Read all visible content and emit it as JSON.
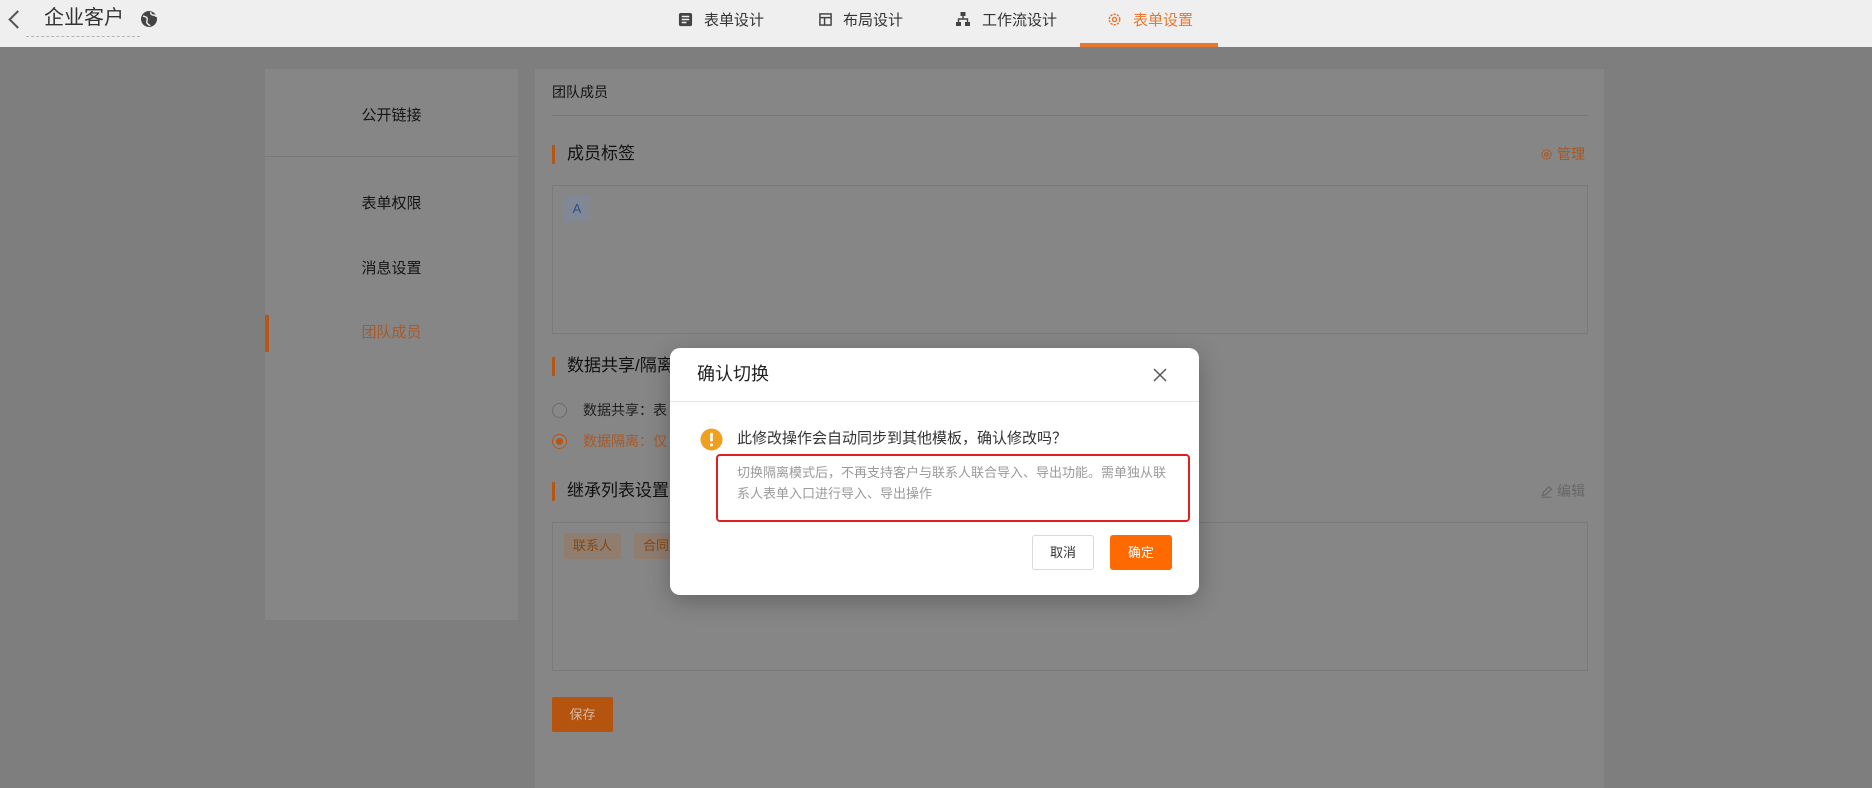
{
  "header": {
    "title": "企业客户",
    "back_icon": "chevron-left-icon",
    "globe_icon": "globe-icon",
    "tabs": [
      {
        "label": "表单设计",
        "icon": "form-icon",
        "active": false
      },
      {
        "label": "布局设计",
        "icon": "layout-icon",
        "active": false
      },
      {
        "label": "工作流设计",
        "icon": "workflow-icon",
        "active": false
      },
      {
        "label": "表单设置",
        "icon": "settings-icon",
        "active": true
      }
    ]
  },
  "sidebar": {
    "items": [
      {
        "label": "公开链接",
        "active": false
      },
      {
        "label": "表单权限",
        "active": false
      },
      {
        "label": "消息设置",
        "active": false
      },
      {
        "label": "团队成员",
        "active": true
      }
    ]
  },
  "main": {
    "heading": "团队成员",
    "member_tags": {
      "title": "成员标签",
      "action_label": "管理",
      "action_icon": "gear-icon",
      "tags": [
        "A"
      ]
    },
    "data_mode": {
      "title": "数据共享/隔离",
      "options": [
        {
          "label": "数据共享：表",
          "checked": false
        },
        {
          "label": "数据隔离：仅",
          "checked": true
        }
      ]
    },
    "inherit_list": {
      "title": "继承列表设置",
      "action_label": "编辑",
      "action_icon": "pencil-icon",
      "tags": [
        "联系人",
        "合同"
      ]
    },
    "save_label": "保存"
  },
  "modal": {
    "title": "确认切换",
    "close_icon": "close-icon",
    "warning_icon": "warning-icon",
    "message": "此修改操作会自动同步到其他模板，确认修改吗？",
    "notice_lines": [
      "切换隔离模式后，不再支持客户与联系人联合导入、导出功能。需单独从联",
      "系人表单入口进行导入、导出操作"
    ],
    "cancel_label": "取消",
    "confirm_label": "确定"
  },
  "colors": {
    "accent": "#ff6a00",
    "tab_active": "#e8772e",
    "warning": "#f0a020",
    "highlight_border": "#e02020"
  }
}
